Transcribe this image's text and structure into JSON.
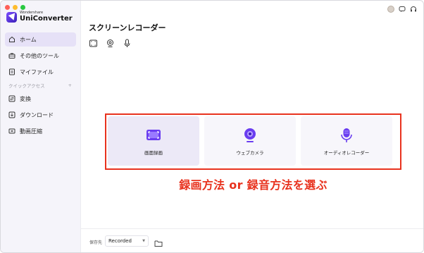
{
  "app": {
    "brand_small": "Wondershare",
    "brand_name": "UniConverter",
    "accent_color": "#6a3df0",
    "annotation_color": "#e8321e"
  },
  "sidebar": {
    "items": [
      {
        "label": "ホーム",
        "icon": "home-icon",
        "active": true
      },
      {
        "label": "その他のツール",
        "icon": "toolbox-icon",
        "active": false
      },
      {
        "label": "マイファイル",
        "icon": "file-icon",
        "active": false
      }
    ],
    "quick_access_label": "クイックアクセス",
    "quick_access_add": "+",
    "quick_items": [
      {
        "label": "変換",
        "icon": "convert-icon"
      },
      {
        "label": "ダウンロード",
        "icon": "download-icon"
      },
      {
        "label": "動画圧縮",
        "icon": "compress-icon"
      }
    ]
  },
  "header_icons": [
    "avatar",
    "chat-icon",
    "support-headset-icon"
  ],
  "main": {
    "title": "スクリーンレコーダー",
    "mode_icons": [
      "screen-capture-icon",
      "webcam-icon",
      "microphone-icon"
    ],
    "options": [
      {
        "label": "画面録画",
        "icon": "screen-record-icon",
        "selected": true
      },
      {
        "label": "ウェブカメラ",
        "icon": "webcam-icon",
        "selected": false
      },
      {
        "label": "オーディオレコーダー",
        "icon": "microphone-icon",
        "selected": false
      }
    ],
    "annotation": "録画方法 or 録音方法を選ぶ"
  },
  "footer": {
    "save_label": "保存先",
    "save_value": "Recorded",
    "folder_icon": "folder-icon"
  }
}
